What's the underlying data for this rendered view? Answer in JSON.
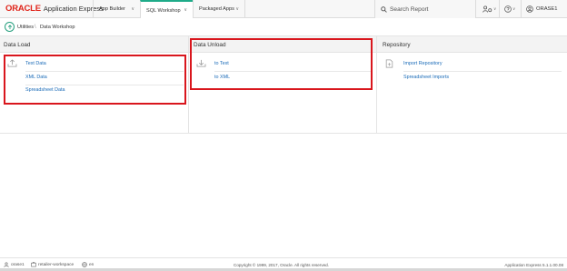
{
  "header": {
    "logo_brand": "ORACLE",
    "logo_product": "Application Express",
    "tabs": [
      {
        "label": "App Builder"
      },
      {
        "label": "SQL Workshop"
      },
      {
        "label": "Packaged Apps"
      }
    ],
    "search_placeholder": "Search Report",
    "username": "ORASE1"
  },
  "breadcrumb": {
    "parent": "Utilities",
    "current": "Data Workshop"
  },
  "panels": {
    "data_load": {
      "title": "Data Load",
      "links": [
        "Text Data",
        "XML Data",
        "Spreadsheet Data"
      ]
    },
    "data_unload": {
      "title": "Data Unload",
      "links": [
        "to Text",
        "to XML"
      ]
    },
    "repository": {
      "title": "Repository",
      "links": [
        "Import Repository",
        "Spreadsheet Imports"
      ]
    }
  },
  "footer": {
    "user": "orase1",
    "workspace": "retailer-workspace",
    "language": "en",
    "copyright": "Copyright © 1999, 2017, Oracle. All rights reserved.",
    "version": "Application Express 5.1.1.00.08"
  },
  "colors": {
    "accent_green": "#1fab89",
    "link_blue": "#1a6bb8",
    "highlight_red": "#d9161d",
    "oracle_red": "#e0241a"
  }
}
